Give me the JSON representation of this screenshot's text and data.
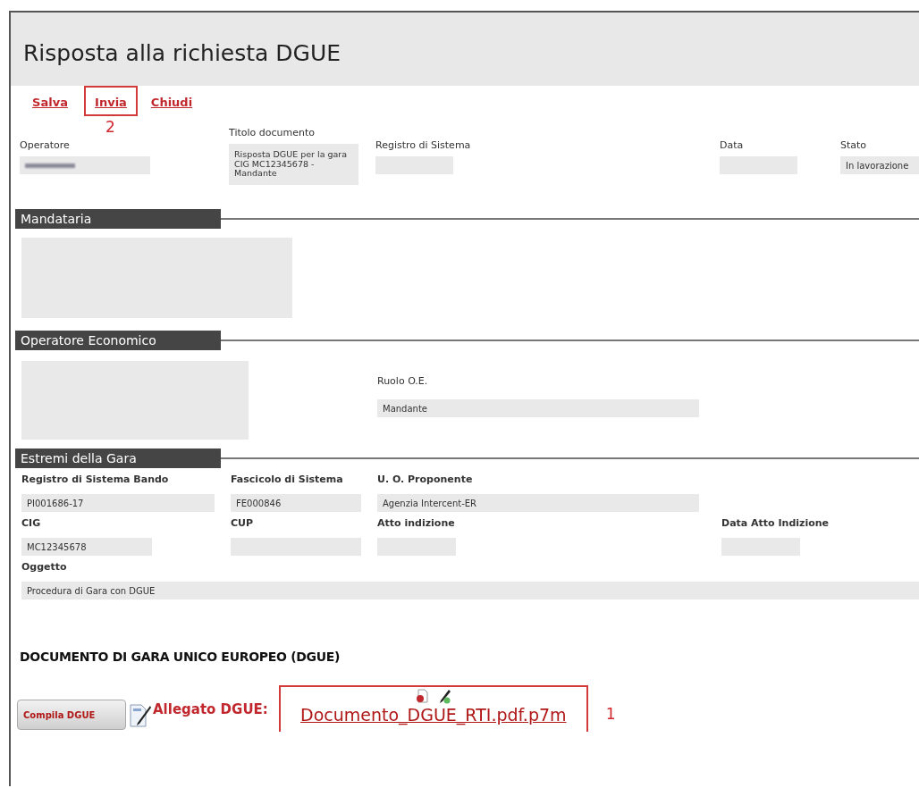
{
  "title": "Risposta alla richiesta DGUE",
  "toolbar": [
    {
      "label": "Salva",
      "highlighted": false
    },
    {
      "label": "Invia",
      "highlighted": true,
      "callout": "2"
    },
    {
      "label": "Chiudi",
      "highlighted": false
    }
  ],
  "header_fields": [
    {
      "label": "Operatore",
      "redacted": true
    },
    {
      "label": "Titolo documento",
      "value": "Risposta DGUE per la gara CIG MC12345678 - Mandante",
      "redacted": false
    },
    {
      "label": "Registro di Sistema",
      "redacted": false
    },
    {
      "label": "Data",
      "redacted": false
    },
    {
      "label": "Stato",
      "value": "In lavorazione",
      "redacted": false
    }
  ],
  "mandataria": {
    "heading": "Mandataria"
  },
  "operatore_economico": {
    "heading": "Operatore Economico",
    "ruolo": {
      "label": "Ruolo O.E.",
      "value": "Mandante"
    }
  },
  "gara": {
    "heading": "Estremi della Gara",
    "row1": [
      {
        "label": "Registro di Sistema Bando",
        "value": "PI001686-17"
      },
      {
        "label": "Fascicolo di Sistema",
        "value": "FE000846"
      },
      {
        "label": "U. O. Proponente",
        "value": "Agenzia Intercent-ER"
      }
    ],
    "row2": [
      {
        "label": "CIG",
        "value": "MC12345678"
      },
      {
        "label": "CUP"
      },
      {
        "label": "Atto indizione"
      },
      {
        "label": "Data Atto Indizione"
      }
    ],
    "oggetto": {
      "label": "Oggetto",
      "value": "Procedura di Gara con DGUE"
    }
  },
  "dgue": {
    "heading": "DOCUMENTO DI GARA UNICO EUROPEO (DGUE)",
    "button": "Compila DGUE",
    "attachment_label": "Allegato DGUE:",
    "file": "Documento_DGUE_RTI.pdf.p7m",
    "callout": "1"
  }
}
